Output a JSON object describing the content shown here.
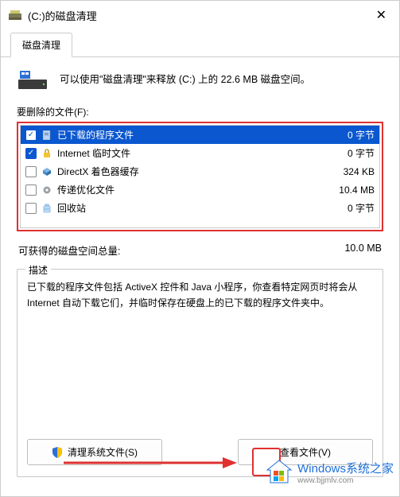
{
  "window": {
    "title": "(C:)的磁盘清理",
    "close_glyph": "✕"
  },
  "tabs": {
    "main": "磁盘清理"
  },
  "info": {
    "text": "可以使用\"磁盘清理\"来释放  (C:) 上的 22.6 MB 磁盘空间。"
  },
  "files": {
    "label": "要删除的文件(F):",
    "items": [
      {
        "checked": true,
        "icon": "page",
        "name": "已下载的程序文件",
        "size": "0 字节",
        "selected": true
      },
      {
        "checked": true,
        "icon": "lock",
        "name": "Internet 临时文件",
        "size": "0 字节",
        "selected": false
      },
      {
        "checked": false,
        "icon": "cube",
        "name": "DirectX 着色器缓存",
        "size": "324 KB",
        "selected": false
      },
      {
        "checked": false,
        "icon": "gear",
        "name": "传递优化文件",
        "size": "10.4 MB",
        "selected": false
      },
      {
        "checked": false,
        "icon": "recycle",
        "name": "回收站",
        "size": "0 字节",
        "selected": false
      }
    ]
  },
  "total": {
    "label": "可获得的磁盘空间总量:",
    "value": "10.0 MB"
  },
  "description": {
    "legend": "描述",
    "text": "已下载的程序文件包括 ActiveX 控件和 Java 小程序，你查看特定网页时将会从 Internet 自动下载它们，并临时保存在硬盘上的已下载的程序文件夹中。"
  },
  "buttons": {
    "clean_system": "清理系统文件(S)",
    "view_files": "查看文件(V)"
  },
  "watermark": {
    "brand": "Windows系统之家",
    "url": "www.bjjmlv.com"
  }
}
